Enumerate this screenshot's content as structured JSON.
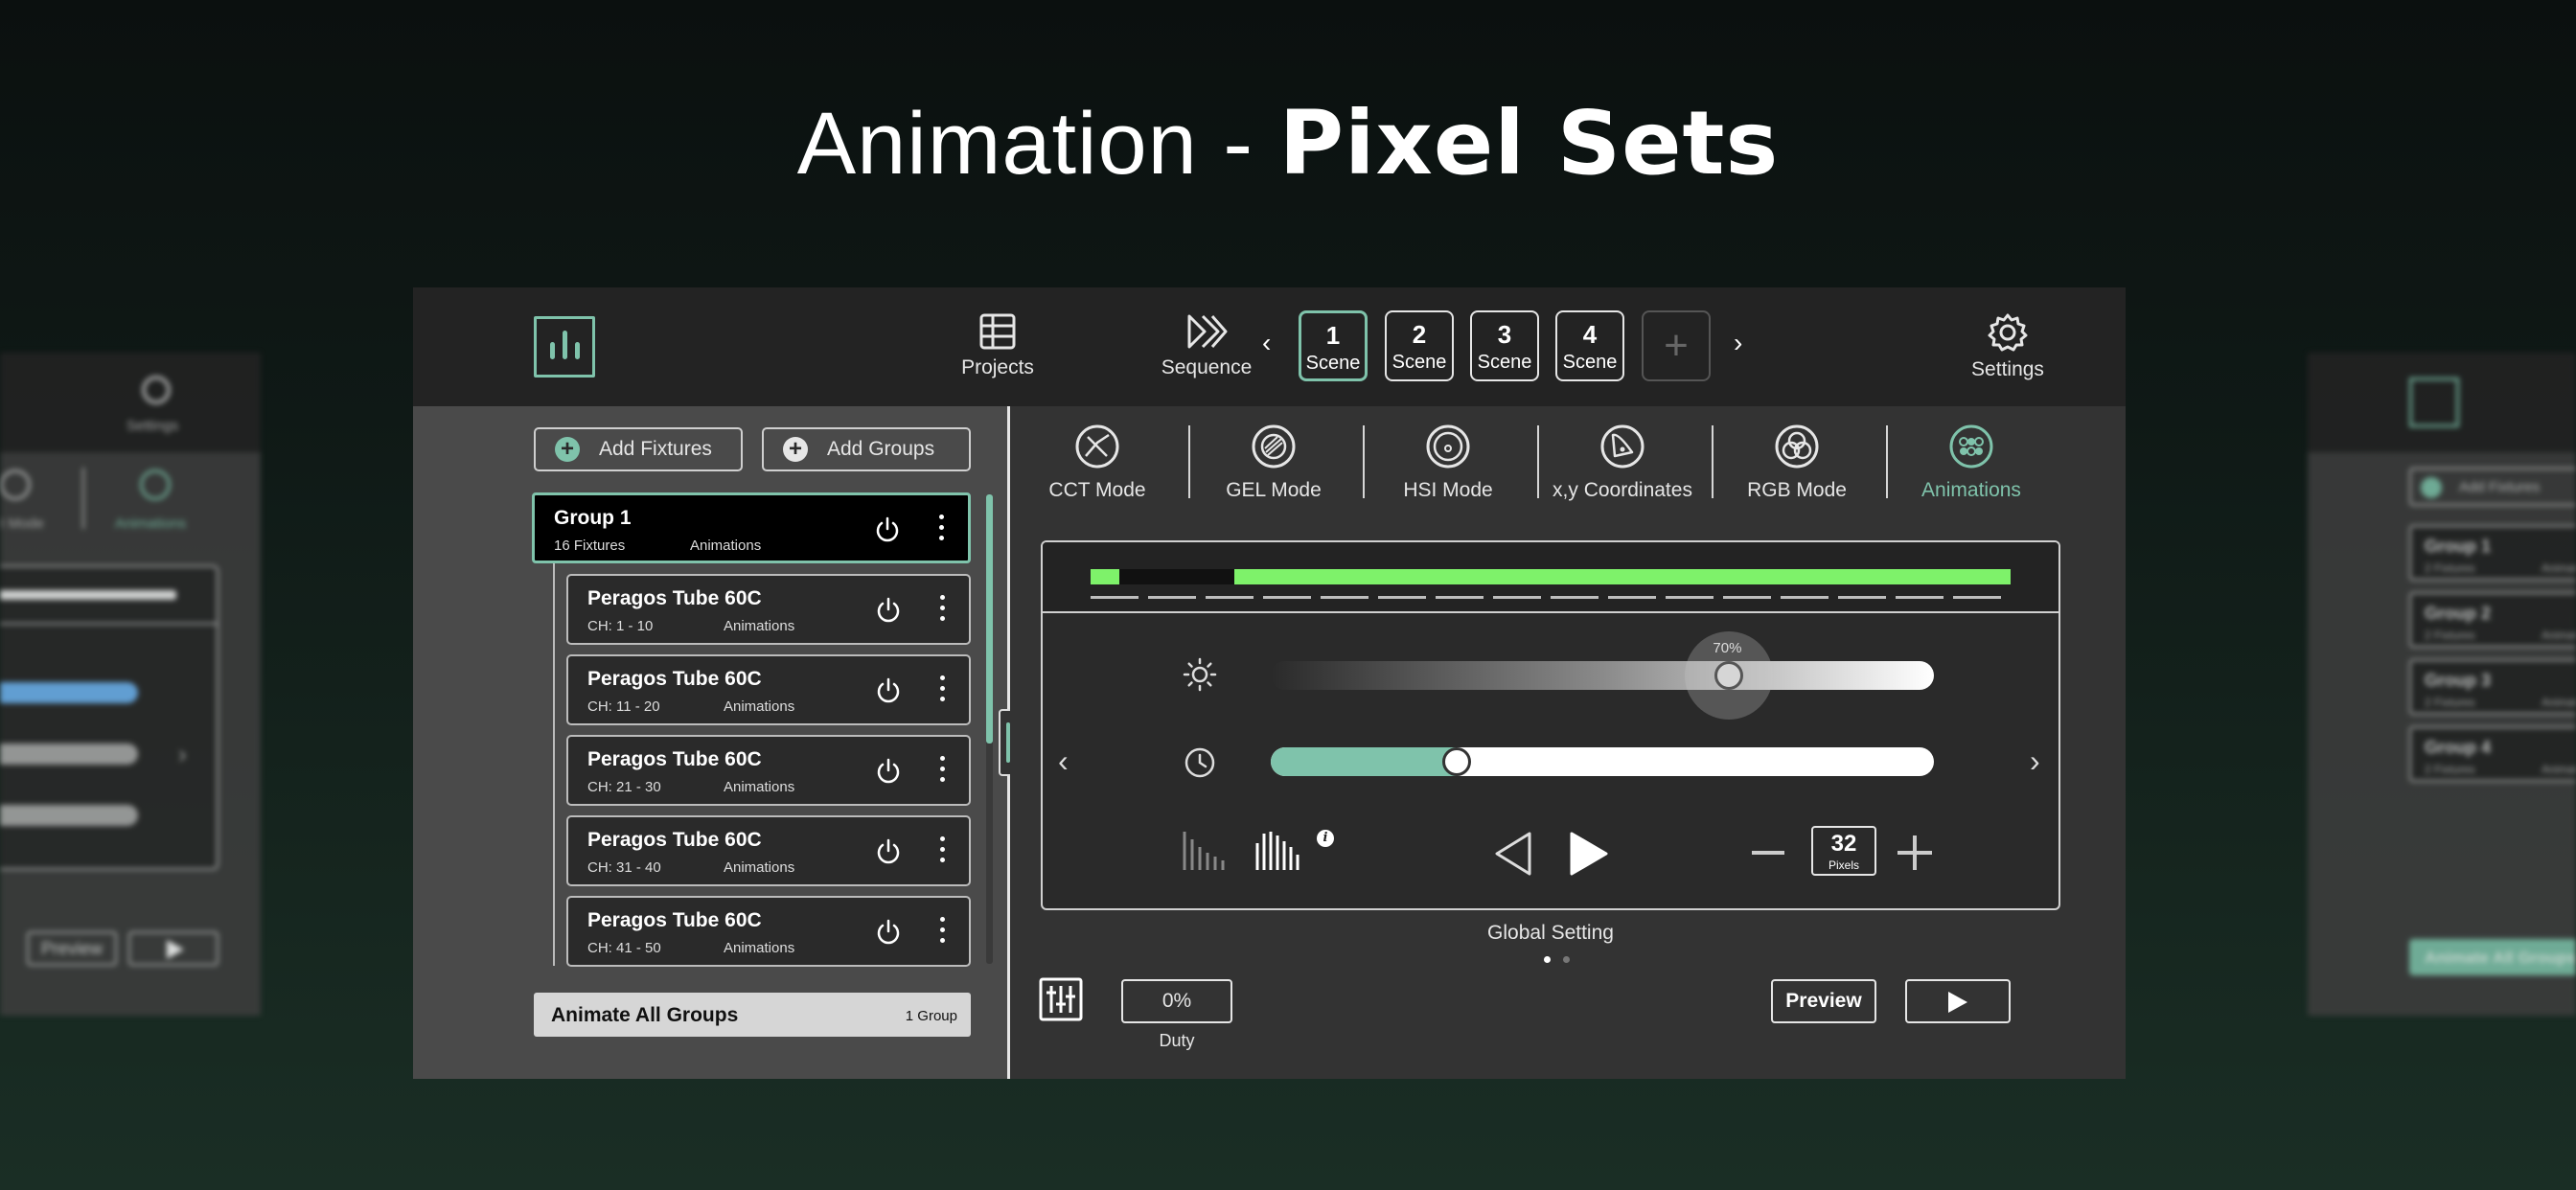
{
  "hero": {
    "light": "Animation - ",
    "bold": "Pixel Sets"
  },
  "topbar": {
    "projects": "Projects",
    "sequence": "Sequence",
    "settings": "Settings",
    "scenes": [
      {
        "num": "1",
        "label": "Scene",
        "active": true
      },
      {
        "num": "2",
        "label": "Scene"
      },
      {
        "num": "3",
        "label": "Scene"
      },
      {
        "num": "4",
        "label": "Scene"
      }
    ]
  },
  "left": {
    "add_fixtures": "Add Fixtures",
    "add_groups": "Add Groups",
    "group": {
      "title": "Group 1",
      "sub": "16 Fixtures",
      "mode": "Animations"
    },
    "fixtures": [
      {
        "title": "Peragos Tube 60C",
        "ch": "CH: 1 - 10",
        "mode": "Animations"
      },
      {
        "title": "Peragos Tube 60C",
        "ch": "CH: 11 - 20",
        "mode": "Animations"
      },
      {
        "title": "Peragos Tube 60C",
        "ch": "CH: 21 - 30",
        "mode": "Animations"
      },
      {
        "title": "Peragos Tube 60C",
        "ch": "CH: 31 - 40",
        "mode": "Animations"
      },
      {
        "title": "Peragos Tube 60C",
        "ch": "CH: 41 - 50",
        "mode": "Animations"
      }
    ],
    "animate_all": "Animate All Groups",
    "animate_count": "1 Group"
  },
  "modes": [
    {
      "label": "CCT Mode",
      "icon": "cct-mode-icon"
    },
    {
      "label": "GEL Mode",
      "icon": "gel-mode-icon"
    },
    {
      "label": "HSI Mode",
      "icon": "hsi-mode-icon"
    },
    {
      "label": "x,y Coordinates",
      "icon": "xy-coordinates-icon"
    },
    {
      "label": "RGB Mode",
      "icon": "rgb-mode-icon"
    },
    {
      "label": "Animations",
      "icon": "animations-icon",
      "active": true
    }
  ],
  "panel": {
    "brightness_pct": "70%",
    "brightness_value": 0.7,
    "speed_value": 0.27,
    "pixels_value": "32",
    "pixels_label": "Pixels",
    "caption": "Global Setting"
  },
  "bottom": {
    "duty_value": "0%",
    "duty_label": "Duty",
    "preview": "Preview"
  },
  "side_left": {
    "settings": "Settings",
    "mode_partial": "I Mode",
    "animations": "Animations",
    "preview": "Preview"
  },
  "side_right": {
    "add_fixtures": "Add Fixtures",
    "groups": [
      {
        "title": "Group 1",
        "sub": "2 Fixtures",
        "mode": "Animati"
      },
      {
        "title": "Group 2",
        "sub": "2 Fixtures",
        "mode": "Animati"
      },
      {
        "title": "Group 3",
        "sub": "2 Fixtures",
        "mode": "Animati"
      },
      {
        "title": "Group 4",
        "sub": "2 Fixtures",
        "mode": "Animati"
      }
    ],
    "animate_all": "Animate All Groups"
  },
  "colors": {
    "accent": "#7fc3ab",
    "pixel_on": "#7ef26a"
  }
}
